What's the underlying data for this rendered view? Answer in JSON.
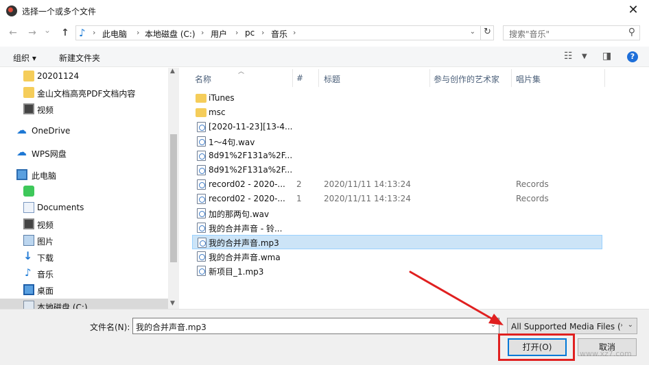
{
  "window": {
    "title": "选择一个或多个文件",
    "close": "✕"
  },
  "nav": {
    "back": "←",
    "forward": "→",
    "recent": "⌄",
    "up": "↑",
    "crumbs": [
      "此电脑",
      "本地磁盘 (C:)",
      "用户",
      "pc",
      "音乐"
    ],
    "separator": "›",
    "search_placeholder": "搜索\"音乐\""
  },
  "toolbar": {
    "organize": "组织 ▾",
    "new_folder": "新建文件夹"
  },
  "sidebar": {
    "items": [
      {
        "label": "20201124",
        "icon": "folder-icon"
      },
      {
        "label": "金山文档高亮PDF文档内容",
        "icon": "folder-icon"
      },
      {
        "label": "视频",
        "icon": "video-icon"
      },
      {
        "label": "OneDrive",
        "icon": "cloud-icon"
      },
      {
        "label": "WPS网盘",
        "icon": "cloud-icon"
      },
      {
        "label": "此电脑",
        "icon": "computer-icon"
      },
      {
        "label": "",
        "icon": "app-icon"
      },
      {
        "label": "Documents",
        "icon": "documents-icon"
      },
      {
        "label": "视频",
        "icon": "video-icon"
      },
      {
        "label": "图片",
        "icon": "pictures-icon"
      },
      {
        "label": "下载",
        "icon": "download-icon"
      },
      {
        "label": "音乐",
        "icon": "music-icon"
      },
      {
        "label": "桌面",
        "icon": "desktop-icon"
      },
      {
        "label": "本地磁盘 (C:)",
        "icon": "drive-icon"
      }
    ]
  },
  "columns": {
    "name": "名称",
    "num": "#",
    "title": "标题",
    "artist": "参与创作的艺术家",
    "album": "唱片集"
  },
  "files": [
    {
      "name": "iTunes",
      "type": "folder",
      "num": "",
      "title": "",
      "album": ""
    },
    {
      "name": "msc",
      "type": "folder",
      "num": "",
      "title": "",
      "album": ""
    },
    {
      "name": "[2020-11-23][13-4...",
      "type": "file",
      "num": "",
      "title": "",
      "album": ""
    },
    {
      "name": "1～4句.wav",
      "type": "file",
      "num": "",
      "title": "",
      "album": ""
    },
    {
      "name": "8d91%2F131a%2F...",
      "type": "file",
      "num": "",
      "title": "",
      "album": ""
    },
    {
      "name": "8d91%2F131a%2F...",
      "type": "file",
      "num": "",
      "title": "",
      "album": ""
    },
    {
      "name": "record02 - 2020-...",
      "type": "file",
      "num": "2",
      "title": "2020/11/11 14:13:24",
      "album": "Records"
    },
    {
      "name": "record02 - 2020-...",
      "type": "file",
      "num": "1",
      "title": "2020/11/11 14:13:24",
      "album": "Records"
    },
    {
      "name": "加的那两句.wav",
      "type": "file",
      "num": "",
      "title": "",
      "album": ""
    },
    {
      "name": "我的合并声音 - 铃...",
      "type": "file",
      "num": "",
      "title": "",
      "album": ""
    },
    {
      "name": "我的合并声音.mp3",
      "type": "file",
      "num": "",
      "title": "",
      "album": "",
      "selected": true
    },
    {
      "name": "我的合并声音.wma",
      "type": "file",
      "num": "",
      "title": "",
      "album": ""
    },
    {
      "name": "新项目_1.mp3",
      "type": "file",
      "num": "",
      "title": "",
      "album": ""
    }
  ],
  "bottom": {
    "filename_label": "文件名(N):",
    "filename_value": "我的合并声音.mp3",
    "filter_value": "All Supported Media Files (*",
    "open_label": "打开(O)",
    "cancel_label": "取消"
  },
  "watermark": {
    "text": "www.xz7.com"
  },
  "colors": {
    "accent": "#0078d7",
    "selection": "#cce4f7",
    "annotation": "#e02020"
  }
}
